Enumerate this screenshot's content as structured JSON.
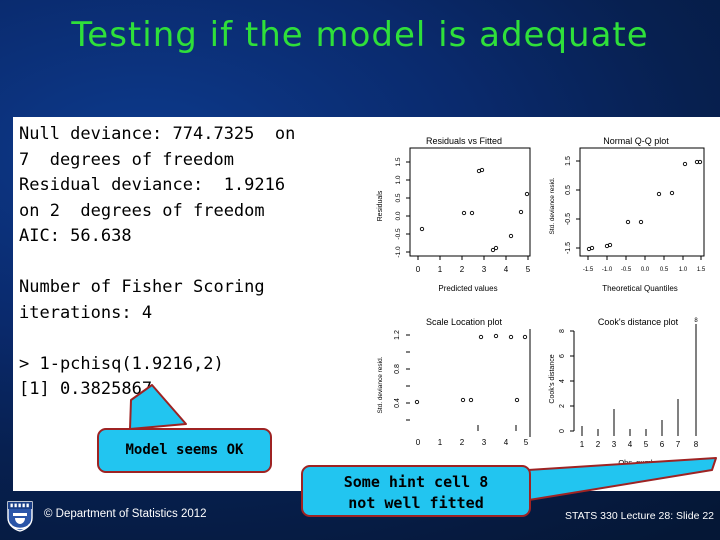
{
  "slide": {
    "title": "Testing if the model is adequate",
    "title_color": "#2fe03a",
    "background_color": "#082257"
  },
  "console": {
    "lines": [
      "Null deviance: 774.7325  on",
      "7  degrees of freedom",
      "Residual deviance:  1.9216",
      "on 2  degrees of freedom",
      "AIC: 56.638",
      "",
      "Number of Fisher Scoring",
      "iterations: 4",
      "",
      "> 1-pchisq(1.9216,2)",
      "[1] 0.3825867"
    ],
    "text": "Null deviance: 774.7325  on\n7  degrees of freedom\nResidual deviance:  1.9216\non 2  degrees of freedom\nAIC: 56.638\n\nNumber of Fisher Scoring\niterations: 4\n\n> 1-pchisq(1.9216,2)\n[1] 0.3825867"
  },
  "callouts": {
    "model_ok": "Model seems OK",
    "hint": "Some hint cell 8\nnot well fitted",
    "fill_color": "#22c5f0",
    "border_color": "#9e2323"
  },
  "footer": {
    "copyright": "© Department of Statistics 2012",
    "slide_ref": "STATS 330 Lecture 28: Slide 22",
    "logo_name": "university-crest"
  },
  "chart_data": [
    {
      "type": "scatter",
      "title": "Residuals vs Fitted",
      "xlabel": "Predicted values",
      "ylabel": "Residuals",
      "xticks": [
        0,
        1,
        2,
        3,
        4,
        5
      ],
      "yticks": [
        -1.0,
        -0.5,
        0.0,
        0.5,
        1.0,
        1.5
      ],
      "xlim": [
        -0.4,
        5.6
      ],
      "ylim": [
        -1.3,
        1.7
      ],
      "x": [
        0.2,
        2.6,
        2.7,
        2.1,
        2.6,
        3.4,
        4.3,
        4.8,
        5.4
      ],
      "y": [
        -0.35,
        1.25,
        1.28,
        0.1,
        0.1,
        -0.95,
        -0.55,
        0.05,
        0.55
      ],
      "grid": false,
      "legend": "none"
    },
    {
      "type": "scatter",
      "title": "Normal Q-Q plot",
      "xlabel": "Theoretical Quantiles",
      "ylabel": "Std. deviance resid.",
      "xticks": [
        -1.5,
        -1.0,
        -0.5,
        0.0,
        0.5,
        1.0,
        1.5
      ],
      "yticks": [
        -1.5,
        -0.5,
        0.5,
        1.5
      ],
      "xlim": [
        -1.7,
        1.7
      ],
      "ylim": [
        -1.7,
        1.7
      ],
      "x": [
        -1.5,
        -1.05,
        -0.6,
        -0.2,
        0.2,
        0.55,
        1.0,
        1.45
      ],
      "y": [
        -1.45,
        -1.35,
        -0.65,
        -0.65,
        0.25,
        0.3,
        1.3,
        1.35
      ],
      "grid": false,
      "legend": "none"
    },
    {
      "type": "scatter",
      "title": "Scale Location plot",
      "xlabel": "Predicted values",
      "ylabel": "Std. deviance resid.",
      "xticks": [
        0,
        1,
        2,
        3,
        4,
        5
      ],
      "yticks": [
        0.4,
        0.8,
        1.2
      ],
      "xlim": [
        -0.4,
        5.6
      ],
      "ylim": [
        0.2,
        1.35
      ],
      "x": [
        0.2,
        2.1,
        2.6,
        2.7,
        3.4,
        4.3,
        4.8,
        5.4
      ],
      "y": [
        0.4,
        0.42,
        0.43,
        1.3,
        1.3,
        1.28,
        1.27,
        0.42
      ],
      "grid": false,
      "legend": "none"
    },
    {
      "type": "bar",
      "title": "Cook's distance plot",
      "xlabel": "Obs. number",
      "ylabel": "Cook's distance",
      "categories": [
        "1",
        "2",
        "3",
        "4",
        "5",
        "6",
        "7",
        "8"
      ],
      "values": [
        0.1,
        0.05,
        1.8,
        0.05,
        0.05,
        0.9,
        2.6,
        8.6
      ],
      "xticks": [
        1,
        2,
        3,
        4,
        5,
        6,
        7,
        8
      ],
      "yticks": [
        0,
        2,
        4,
        6,
        8
      ],
      "ylim": [
        0,
        8.7
      ],
      "labeled_point": "8",
      "grid": false,
      "legend": "none"
    }
  ]
}
